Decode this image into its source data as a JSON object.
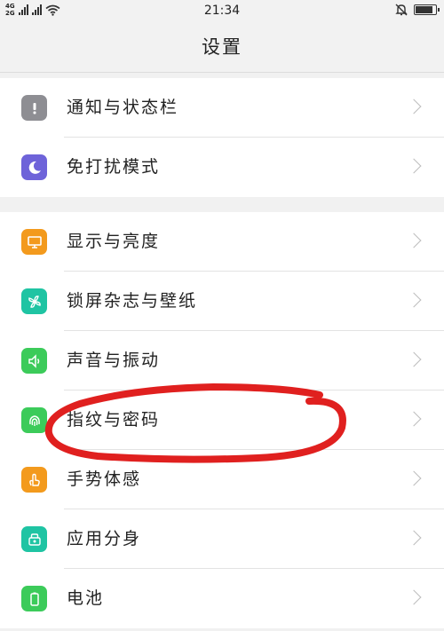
{
  "status_bar": {
    "network_top": "4G",
    "network_bottom": "2G",
    "time": "21:34"
  },
  "title": "设置",
  "groups": [
    {
      "items": [
        {
          "label": "通知与状态栏",
          "icon": "exclamation-icon",
          "icon_color": "#8e8e93"
        },
        {
          "label": "免打扰模式",
          "icon": "moon-icon",
          "icon_color": "#6e63d9"
        }
      ]
    },
    {
      "items": [
        {
          "label": "显示与亮度",
          "icon": "display-icon",
          "icon_color": "#f39a1d"
        },
        {
          "label": "锁屏杂志与壁纸",
          "icon": "pinwheel-icon",
          "icon_color": "#1fc4a3"
        },
        {
          "label": "声音与振动",
          "icon": "speaker-icon",
          "icon_color": "#3ccb5a"
        },
        {
          "label": "指纹与密码",
          "icon": "fingerprint-icon",
          "icon_color": "#3ccb5a"
        },
        {
          "label": "手势体感",
          "icon": "hand-icon",
          "icon_color": "#f39a1d"
        },
        {
          "label": "应用分身",
          "icon": "clone-icon",
          "icon_color": "#1fc4a3"
        },
        {
          "label": "电池",
          "icon": "battery-icon",
          "icon_color": "#3ccb5a"
        }
      ]
    }
  ],
  "annotation_color": "#e0201f"
}
